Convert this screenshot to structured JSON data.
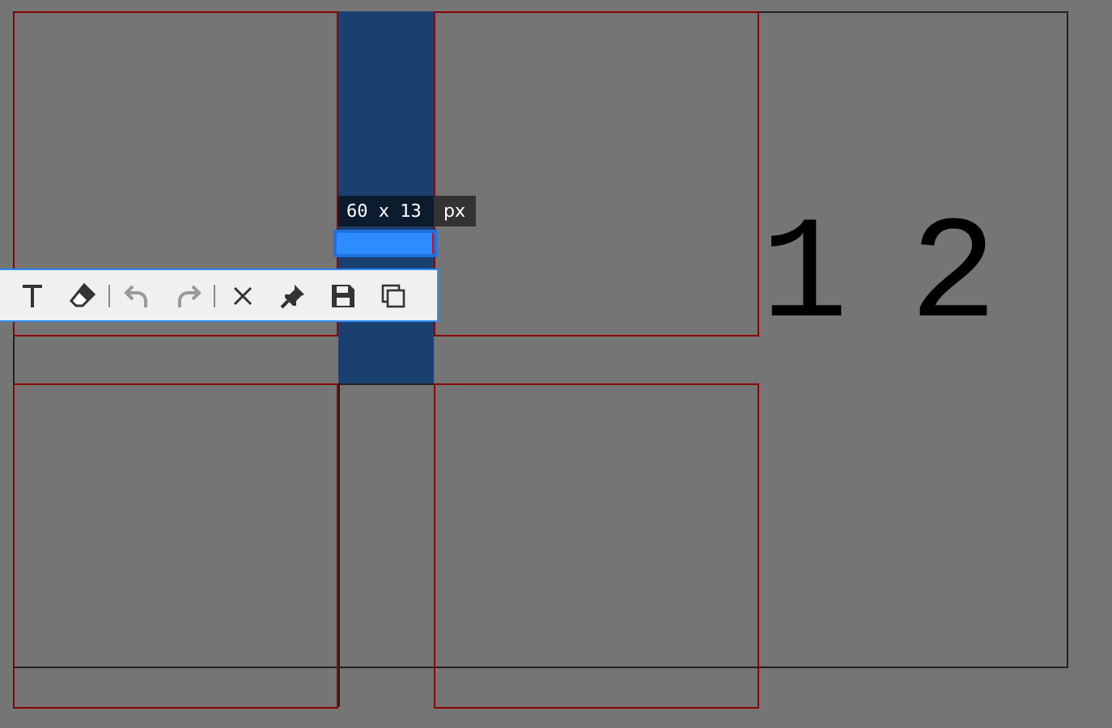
{
  "selection": {
    "size": "60 x 13",
    "unit": "px"
  },
  "toolbar": [
    {
      "kind": "text",
      "disabled": false
    },
    {
      "kind": "eraser",
      "disabled": false
    },
    {
      "kind": "sep"
    },
    {
      "kind": "undo",
      "disabled": true
    },
    {
      "kind": "redo",
      "disabled": true
    },
    {
      "kind": "sep"
    },
    {
      "kind": "close",
      "disabled": false
    },
    {
      "kind": "pin",
      "disabled": false
    },
    {
      "kind": "save",
      "disabled": false
    },
    {
      "kind": "copy",
      "disabled": false
    }
  ],
  "canvas_text": [
    "1",
    "2"
  ]
}
